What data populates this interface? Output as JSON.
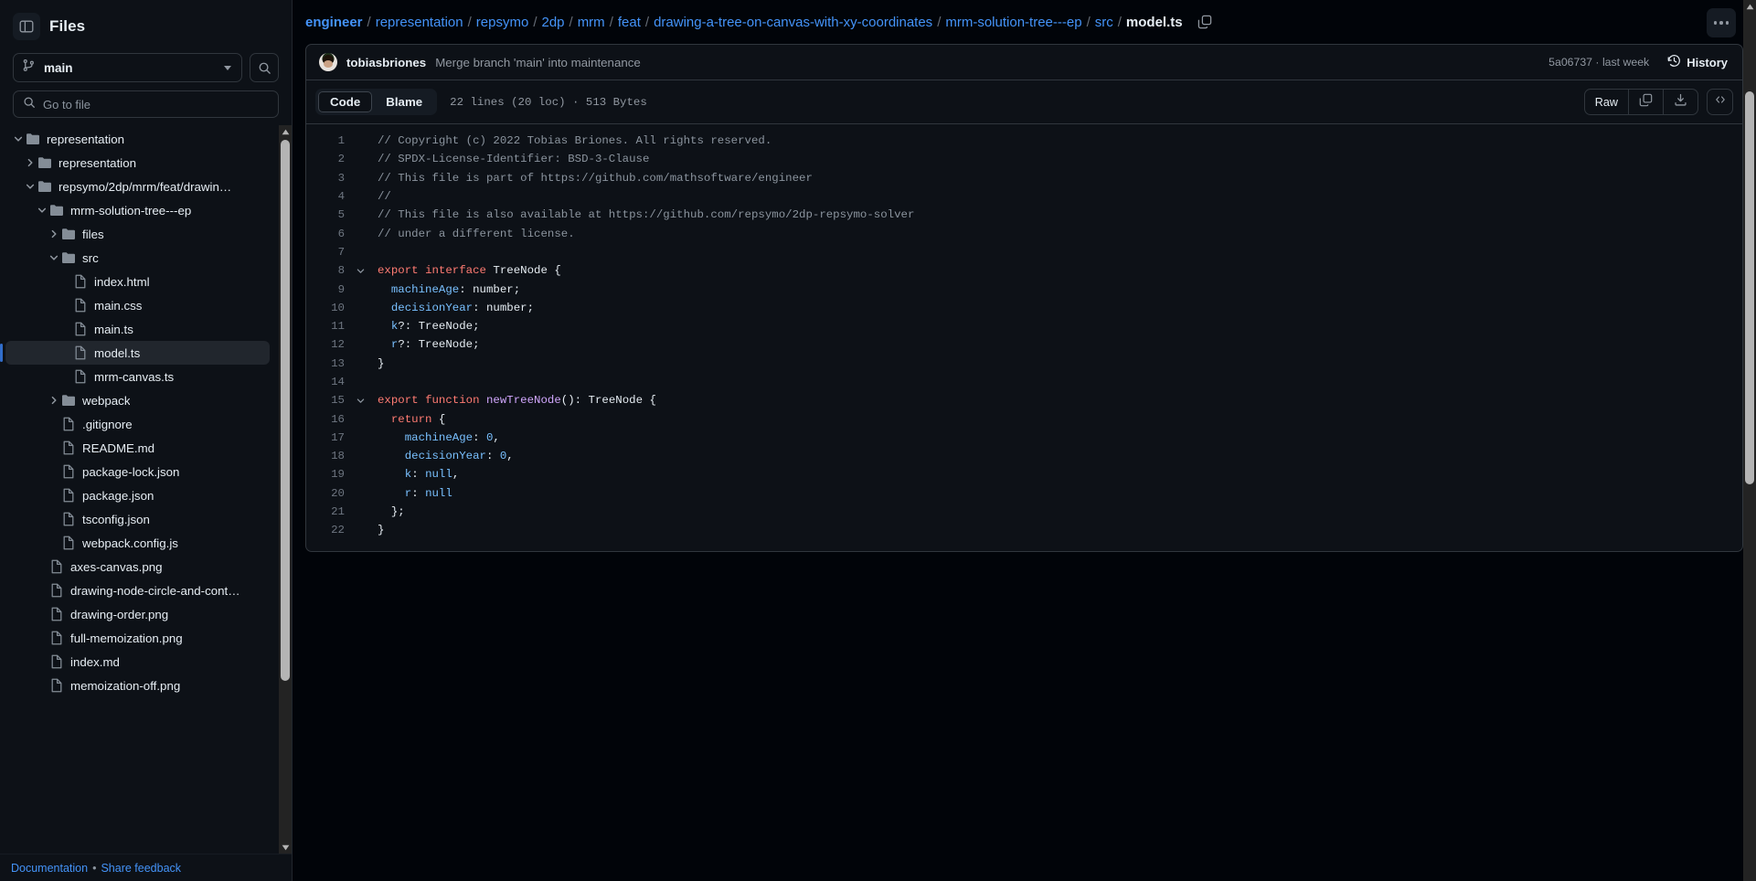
{
  "sidebar": {
    "title": "Files",
    "toggle_icon": "sidebar-collapse-icon",
    "branch": {
      "name": "main",
      "icon": "git-branch-icon"
    },
    "search_icon": "search-icon",
    "filter": {
      "placeholder": "Go to file",
      "value": "",
      "icon": "search-icon"
    },
    "tree": [
      {
        "label": "representation",
        "type": "folder",
        "depth": 0,
        "expanded": true,
        "selected": false
      },
      {
        "label": "representation",
        "type": "folder",
        "depth": 1,
        "expanded": false,
        "selected": false
      },
      {
        "label": "repsymo/2dp/mrm/feat/drawin…",
        "type": "folder",
        "depth": 1,
        "expanded": true,
        "selected": false
      },
      {
        "label": "mrm-solution-tree---ep",
        "type": "folder",
        "depth": 2,
        "expanded": true,
        "selected": false
      },
      {
        "label": "files",
        "type": "folder",
        "depth": 3,
        "expanded": false,
        "selected": false
      },
      {
        "label": "src",
        "type": "folder",
        "depth": 3,
        "expanded": true,
        "selected": false
      },
      {
        "label": "index.html",
        "type": "file",
        "depth": 4,
        "selected": false
      },
      {
        "label": "main.css",
        "type": "file",
        "depth": 4,
        "selected": false
      },
      {
        "label": "main.ts",
        "type": "file",
        "depth": 4,
        "selected": false
      },
      {
        "label": "model.ts",
        "type": "file",
        "depth": 4,
        "selected": true
      },
      {
        "label": "mrm-canvas.ts",
        "type": "file",
        "depth": 4,
        "selected": false
      },
      {
        "label": "webpack",
        "type": "folder",
        "depth": 3,
        "expanded": false,
        "selected": false
      },
      {
        "label": ".gitignore",
        "type": "file",
        "depth": 3,
        "selected": false
      },
      {
        "label": "README.md",
        "type": "file",
        "depth": 3,
        "selected": false
      },
      {
        "label": "package-lock.json",
        "type": "file",
        "depth": 3,
        "selected": false
      },
      {
        "label": "package.json",
        "type": "file",
        "depth": 3,
        "selected": false
      },
      {
        "label": "tsconfig.json",
        "type": "file",
        "depth": 3,
        "selected": false
      },
      {
        "label": "webpack.config.js",
        "type": "file",
        "depth": 3,
        "selected": false
      },
      {
        "label": "axes-canvas.png",
        "type": "file",
        "depth": 2,
        "selected": false
      },
      {
        "label": "drawing-node-circle-and-cont…",
        "type": "file",
        "depth": 2,
        "selected": false
      },
      {
        "label": "drawing-order.png",
        "type": "file",
        "depth": 2,
        "selected": false
      },
      {
        "label": "full-memoization.png",
        "type": "file",
        "depth": 2,
        "selected": false
      },
      {
        "label": "index.md",
        "type": "file",
        "depth": 2,
        "selected": false
      },
      {
        "label": "memoization-off.png",
        "type": "file",
        "depth": 2,
        "selected": false
      }
    ],
    "footer": {
      "documentation": "Documentation",
      "separator": "•",
      "feedback": "Share feedback"
    }
  },
  "breadcrumb": {
    "items": [
      {
        "label": "engineer",
        "link": true,
        "bold": true
      },
      {
        "label": "representation",
        "link": true
      },
      {
        "label": "repsymo",
        "link": true
      },
      {
        "label": "2dp",
        "link": true
      },
      {
        "label": "mrm",
        "link": true
      },
      {
        "label": "feat",
        "link": true
      },
      {
        "label": "drawing-a-tree-on-canvas-with-xy-coordinates",
        "link": true
      },
      {
        "label": "mrm-solution-tree---ep",
        "link": true
      },
      {
        "label": "src",
        "link": true
      },
      {
        "label": "model.ts",
        "link": false,
        "current": true
      }
    ],
    "separator": "/",
    "copy_icon": "copy-path-icon",
    "more_icon": "kebab-menu-icon"
  },
  "commit": {
    "avatar_name": "author-avatar",
    "author": "tobiasbriones",
    "message": "Merge branch 'main' into maintenance",
    "sha_and_time": "5a06737 · last week",
    "history_label": "History",
    "history_icon": "history-clock-icon"
  },
  "filebar": {
    "tabs": [
      {
        "label": "Code",
        "active": true
      },
      {
        "label": "Blame",
        "active": false
      }
    ],
    "stats": "22 lines (20 loc) · 513 Bytes",
    "raw_label": "Raw",
    "copy_icon": "copy-icon",
    "download_icon": "download-icon",
    "symbols_icon": "code-brackets-icon"
  },
  "code": {
    "lines": [
      {
        "n": "1",
        "fold": false,
        "tokens": [
          {
            "t": "// Copyright (c) 2022 Tobias Briones. All rights reserved.",
            "c": "t-cmt"
          }
        ]
      },
      {
        "n": "2",
        "fold": false,
        "tokens": [
          {
            "t": "// SPDX-License-Identifier: BSD-3-Clause",
            "c": "t-cmt"
          }
        ]
      },
      {
        "n": "3",
        "fold": false,
        "tokens": [
          {
            "t": "// This file is part of https://github.com/mathsoftware/engineer",
            "c": "t-cmt"
          }
        ]
      },
      {
        "n": "4",
        "fold": false,
        "tokens": [
          {
            "t": "//",
            "c": "t-cmt"
          }
        ]
      },
      {
        "n": "5",
        "fold": false,
        "tokens": [
          {
            "t": "// This file is also available at https://github.com/repsymo/2dp-repsymo-solver",
            "c": "t-cmt"
          }
        ]
      },
      {
        "n": "6",
        "fold": false,
        "tokens": [
          {
            "t": "// under a different license.",
            "c": "t-cmt"
          }
        ]
      },
      {
        "n": "7",
        "fold": false,
        "tokens": []
      },
      {
        "n": "8",
        "fold": true,
        "tokens": [
          {
            "t": "export",
            "c": "t-kw"
          },
          {
            "t": " ",
            "c": "t-pln"
          },
          {
            "t": "interface",
            "c": "t-kw"
          },
          {
            "t": " TreeNode {",
            "c": "t-typ"
          }
        ]
      },
      {
        "n": "9",
        "fold": false,
        "tokens": [
          {
            "t": "  ",
            "c": "t-pln"
          },
          {
            "t": "machineAge",
            "c": "t-var"
          },
          {
            "t": ": number;",
            "c": "t-typ"
          }
        ]
      },
      {
        "n": "10",
        "fold": false,
        "tokens": [
          {
            "t": "  ",
            "c": "t-pln"
          },
          {
            "t": "decisionYear",
            "c": "t-var"
          },
          {
            "t": ": number;",
            "c": "t-typ"
          }
        ]
      },
      {
        "n": "11",
        "fold": false,
        "tokens": [
          {
            "t": "  ",
            "c": "t-pln"
          },
          {
            "t": "k",
            "c": "t-var"
          },
          {
            "t": "?: TreeNode;",
            "c": "t-typ"
          }
        ]
      },
      {
        "n": "12",
        "fold": false,
        "tokens": [
          {
            "t": "  ",
            "c": "t-pln"
          },
          {
            "t": "r",
            "c": "t-var"
          },
          {
            "t": "?: TreeNode;",
            "c": "t-typ"
          }
        ]
      },
      {
        "n": "13",
        "fold": false,
        "tokens": [
          {
            "t": "}",
            "c": "t-typ"
          }
        ]
      },
      {
        "n": "14",
        "fold": false,
        "tokens": []
      },
      {
        "n": "15",
        "fold": true,
        "tokens": [
          {
            "t": "export",
            "c": "t-kw"
          },
          {
            "t": " ",
            "c": "t-pln"
          },
          {
            "t": "function",
            "c": "t-kw"
          },
          {
            "t": " ",
            "c": "t-pln"
          },
          {
            "t": "newTreeNode",
            "c": "t-ent"
          },
          {
            "t": "(): TreeNode {",
            "c": "t-typ"
          }
        ]
      },
      {
        "n": "16",
        "fold": false,
        "tokens": [
          {
            "t": "  ",
            "c": "t-pln"
          },
          {
            "t": "return",
            "c": "t-kw"
          },
          {
            "t": " {",
            "c": "t-typ"
          }
        ]
      },
      {
        "n": "17",
        "fold": false,
        "tokens": [
          {
            "t": "    ",
            "c": "t-pln"
          },
          {
            "t": "machineAge",
            "c": "t-var"
          },
          {
            "t": ": ",
            "c": "t-typ"
          },
          {
            "t": "0",
            "c": "t-con"
          },
          {
            "t": ",",
            "c": "t-typ"
          }
        ]
      },
      {
        "n": "18",
        "fold": false,
        "tokens": [
          {
            "t": "    ",
            "c": "t-pln"
          },
          {
            "t": "decisionYear",
            "c": "t-var"
          },
          {
            "t": ": ",
            "c": "t-typ"
          },
          {
            "t": "0",
            "c": "t-con"
          },
          {
            "t": ",",
            "c": "t-typ"
          }
        ]
      },
      {
        "n": "19",
        "fold": false,
        "tokens": [
          {
            "t": "    ",
            "c": "t-pln"
          },
          {
            "t": "k",
            "c": "t-var"
          },
          {
            "t": ": ",
            "c": "t-typ"
          },
          {
            "t": "null",
            "c": "t-con"
          },
          {
            "t": ",",
            "c": "t-typ"
          }
        ]
      },
      {
        "n": "20",
        "fold": false,
        "tokens": [
          {
            "t": "    ",
            "c": "t-pln"
          },
          {
            "t": "r",
            "c": "t-var"
          },
          {
            "t": ": ",
            "c": "t-typ"
          },
          {
            "t": "null",
            "c": "t-con"
          }
        ]
      },
      {
        "n": "21",
        "fold": false,
        "tokens": [
          {
            "t": "  };",
            "c": "t-typ"
          }
        ]
      },
      {
        "n": "22",
        "fold": false,
        "tokens": [
          {
            "t": "}",
            "c": "t-typ"
          }
        ]
      }
    ]
  },
  "colors": {
    "page_bg": "#010409",
    "panel_bg": "#0d1117",
    "border": "#30363d",
    "link": "#4493f8",
    "accent": "#316dca",
    "muted": "#9198a1",
    "text": "#e6edf3",
    "keyword": "#ff7b72",
    "entity": "#d2a8ff",
    "variable": "#79c0ff",
    "comment": "#8b949e"
  }
}
